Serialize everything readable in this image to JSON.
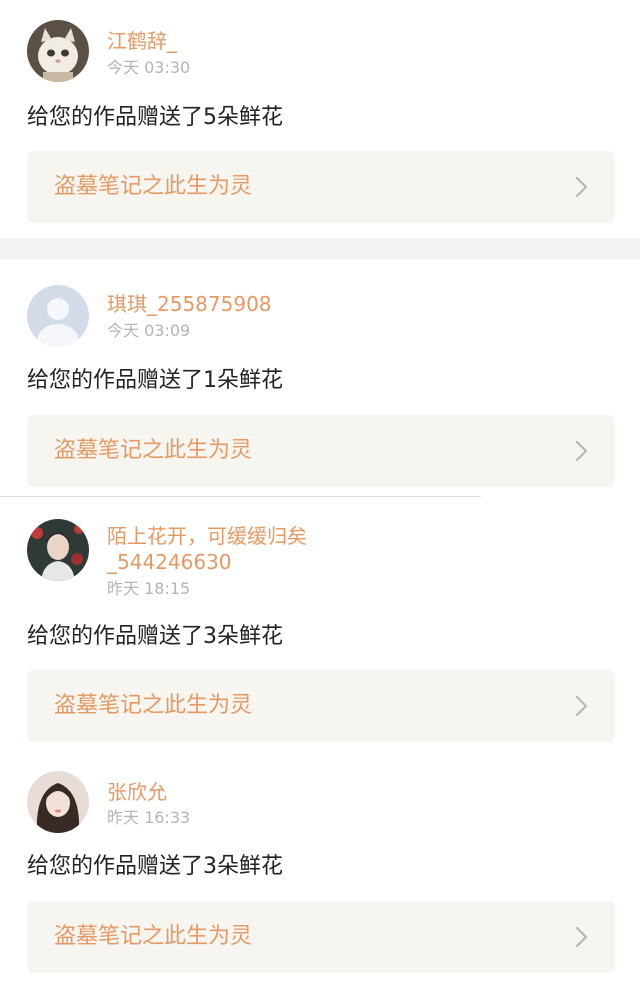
{
  "notifications": [
    {
      "username": "江鹤辞_",
      "time": "今天 03:30",
      "message": "给您的作品赠送了5朵鲜花",
      "work_title": "盗墓笔记之此生为灵",
      "avatar": "cat-avatar"
    },
    {
      "username": "琪琪_255875908",
      "time": "今天 03:09",
      "message": "给您的作品赠送了1朵鲜花",
      "work_title": "盗墓笔记之此生为灵",
      "avatar": "default-avatar"
    },
    {
      "username": "陌上花开，可缓缓归矣\n_544246630",
      "time": "昨天 18:15",
      "message": "给您的作品赠送了3朵鲜花",
      "work_title": "盗墓笔记之此生为灵",
      "avatar": "boy-avatar"
    },
    {
      "username": "张欣允",
      "time": "昨天 16:33",
      "message": "给您的作品赠送了3朵鲜花",
      "work_title": "盗墓笔记之此生为灵",
      "avatar": "girl-avatar"
    }
  ],
  "icons": {
    "chevron": "chevron-right-icon"
  },
  "colors": {
    "username": "#e59a65",
    "timestamp": "#b4b4b4",
    "message": "#222222",
    "link_background": "#f6f5ef",
    "section_gap": "#f3f3f3"
  }
}
